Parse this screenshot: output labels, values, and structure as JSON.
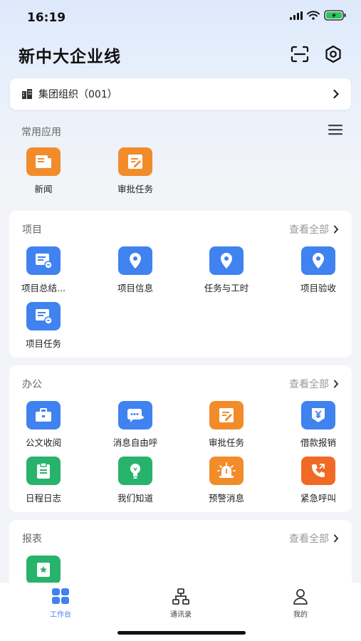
{
  "status": {
    "time": "16:19"
  },
  "header": {
    "title": "新中大企业线"
  },
  "org": {
    "label": "集团组织（001）"
  },
  "common": {
    "title": "常用应用",
    "apps": [
      {
        "label": "新闻"
      },
      {
        "label": "审批任务"
      }
    ]
  },
  "project": {
    "title": "项目",
    "view_all": "查看全部",
    "apps": [
      {
        "label": "项目总结..."
      },
      {
        "label": "项目信息"
      },
      {
        "label": "任务与工时"
      },
      {
        "label": "项目验收"
      },
      {
        "label": "项目任务"
      }
    ]
  },
  "office": {
    "title": "办公",
    "view_all": "查看全部",
    "apps": [
      {
        "label": "公文收阅"
      },
      {
        "label": "消息自由呼"
      },
      {
        "label": "审批任务"
      },
      {
        "label": "借款报销"
      },
      {
        "label": "日程日志"
      },
      {
        "label": "我们知道"
      },
      {
        "label": "预警消息"
      },
      {
        "label": "紧急呼叫"
      }
    ]
  },
  "report": {
    "title": "报表",
    "view_all": "查看全部"
  },
  "tabbar": {
    "tabs": [
      {
        "label": "工作台"
      },
      {
        "label": "通讯录"
      },
      {
        "label": "我的"
      }
    ]
  },
  "colors": {
    "accent": "#3f82f0",
    "orange": "#f28c2a",
    "green": "#27b36b"
  }
}
